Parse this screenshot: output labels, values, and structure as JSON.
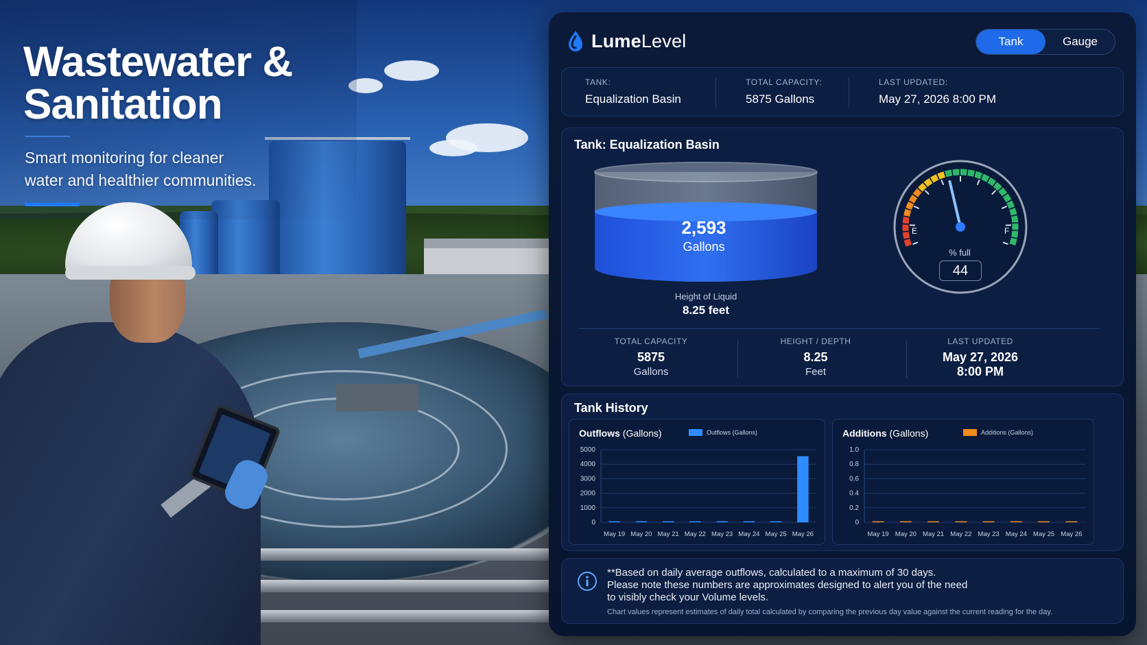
{
  "hero": {
    "title_line1": "Wastewater &",
    "title_line2": "Sanitation",
    "subtitle_line1": "Smart monitoring for cleaner",
    "subtitle_line2": "water and healthier communities."
  },
  "brand": {
    "name_bold": "Lume",
    "name_rest": "Level",
    "icon": "water-drop-icon"
  },
  "view_toggle": {
    "options": [
      "Tank",
      "Gauge"
    ],
    "selected": "Tank"
  },
  "info": {
    "tank_label": "TANK:",
    "tank_value": "Equalization Basin",
    "capacity_label": "TOTAL CAPACITY:",
    "capacity_value": "5875 Gallons",
    "updated_label": "LAST UPDATED:",
    "updated_value": "May 27, 2026 8:00 PM"
  },
  "tank_panel": {
    "title": "Tank: Equalization Basin",
    "volume_number": "2,593",
    "volume_unit": "Gallons",
    "fill_fraction": 0.44,
    "liquid_label": "Height of Liquid",
    "liquid_value": "8.25 feet",
    "gauge": {
      "empty_label": "E",
      "full_label": "F",
      "pct_label": "% full",
      "pct_value": "44",
      "pct_number": 44
    },
    "stats": [
      {
        "label": "TOTAL CAPACITY",
        "value": "5875",
        "unit": "Gallons"
      },
      {
        "label": "HEIGHT / DEPTH",
        "value": "8.25",
        "unit": "Feet"
      },
      {
        "label": "LAST UPDATED",
        "value": "May 27, 2026",
        "unit": "8:00 PM"
      }
    ]
  },
  "history": {
    "title": "Tank History",
    "outflows": {
      "title_bold": "Outflows",
      "title_rest": "(Gallons)",
      "legend": "Outflows (Gallons)",
      "color": "#2f8cff"
    },
    "additions": {
      "title_bold": "Additions",
      "title_rest": "(Gallons)",
      "legend": "Additions (Gallons)",
      "color": "#f08a1c"
    }
  },
  "chart_data": [
    {
      "type": "bar",
      "title": "Outflows (Gallons)",
      "categories": [
        "May 19",
        "May 20",
        "May 21",
        "May 22",
        "May 23",
        "May 24",
        "May 25",
        "May 26"
      ],
      "series": [
        {
          "name": "Outflows (Gallons)",
          "values": [
            0,
            0,
            0,
            0,
            0,
            0,
            0,
            4550
          ]
        }
      ],
      "ylim": [
        0,
        5000
      ],
      "yticks": [
        0,
        1000,
        2000,
        3000,
        4000,
        5000
      ],
      "ytick_labels": [
        "0",
        "1000",
        "2000",
        "3000",
        "4000",
        "5000"
      ],
      "grid": true,
      "legend": "top"
    },
    {
      "type": "bar",
      "title": "Additions (Gallons)",
      "categories": [
        "May 19",
        "May 20",
        "May 21",
        "May 22",
        "May 23",
        "May 24",
        "May 25",
        "May 26"
      ],
      "series": [
        {
          "name": "Additions (Gallons)",
          "values": [
            0,
            0,
            0,
            0,
            0,
            0,
            0,
            0
          ]
        }
      ],
      "ylim": [
        0,
        1.0
      ],
      "yticks": [
        0,
        0.2,
        0.4,
        0.6,
        0.8,
        1.0
      ],
      "ytick_labels": [
        "0",
        "0.2",
        "0.4",
        "0.6",
        "0.8",
        "1.0"
      ],
      "grid": true,
      "legend": "top"
    }
  ],
  "note": {
    "icon": "info-icon",
    "line1": "**Based on daily average outflows, calculated to a maximum of 30 days.",
    "line2": "Please note these numbers are approximates designed to alert you of the need",
    "line3": "to visibly check your Volume levels.",
    "small": "Chart values represent estimates of daily total calculated by comparing the previous day value against the current reading for the day."
  }
}
